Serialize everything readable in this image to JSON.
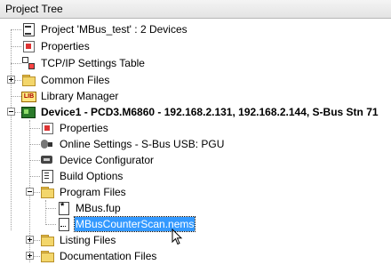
{
  "panel": {
    "title": "Project Tree"
  },
  "tree": [
    {
      "id": "project",
      "label": "Project 'MBus_test' : 2 Devices",
      "icon": "project-icon"
    },
    {
      "id": "properties",
      "label": "Properties",
      "icon": "properties-icon"
    },
    {
      "id": "tcpip",
      "label": "TCP/IP Settings Table",
      "icon": "network-icon"
    },
    {
      "id": "common-files",
      "label": "Common Files",
      "icon": "folder-icon"
    },
    {
      "id": "library-manager",
      "label": "Library Manager",
      "icon": "library-icon"
    },
    {
      "id": "device1",
      "label": "Device1 - PCD3.M6860 - 192.168.2.131, 192.168.2.144, S-Bus Stn 71",
      "icon": "plc-icon"
    },
    {
      "id": "device-properties",
      "label": "Properties",
      "icon": "properties-icon"
    },
    {
      "id": "online-settings",
      "label": "Online Settings - S-Bus USB: PGU",
      "icon": "online-settings-icon"
    },
    {
      "id": "device-configurator",
      "label": "Device Configurator",
      "icon": "configurator-icon"
    },
    {
      "id": "build-options",
      "label": "Build Options",
      "icon": "build-options-icon"
    },
    {
      "id": "program-files",
      "label": "Program Files",
      "icon": "folder-icon"
    },
    {
      "id": "mbus-fup",
      "label": "MBus.fup",
      "icon": "fup-file-icon"
    },
    {
      "id": "mbus-counter",
      "label": "MBusCounterScan.nems",
      "icon": "nems-file-icon"
    },
    {
      "id": "listing-files",
      "label": "Listing Files",
      "icon": "folder-icon"
    },
    {
      "id": "documentation-files",
      "label": "Documentation Files",
      "icon": "folder-icon"
    }
  ]
}
